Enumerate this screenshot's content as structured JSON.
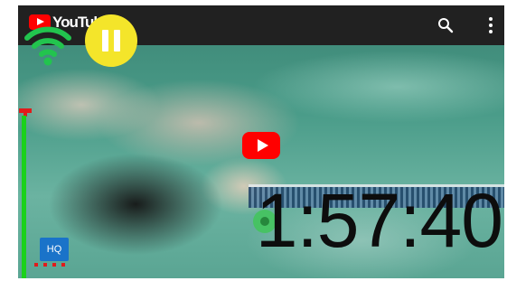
{
  "app": {
    "title": "YouTube"
  },
  "toolbar": {
    "search_icon": "search-icon",
    "more_icon": "more-vertical-icon"
  },
  "overlay": {
    "pause_icon": "pause-icon",
    "wifi_icon": "wifi-icon",
    "play_icon": "youtube-play-icon",
    "quality_badge": "HQ",
    "timer": "1:57:40"
  },
  "colors": {
    "topbar": "#212121",
    "youtube_red": "#ff0000",
    "wifi_green": "#22c44e",
    "pause_yellow": "#f4e52a",
    "volume_green": "#1bd11b",
    "volume_red": "#e11b1b",
    "hq_blue": "#1a73c9"
  }
}
